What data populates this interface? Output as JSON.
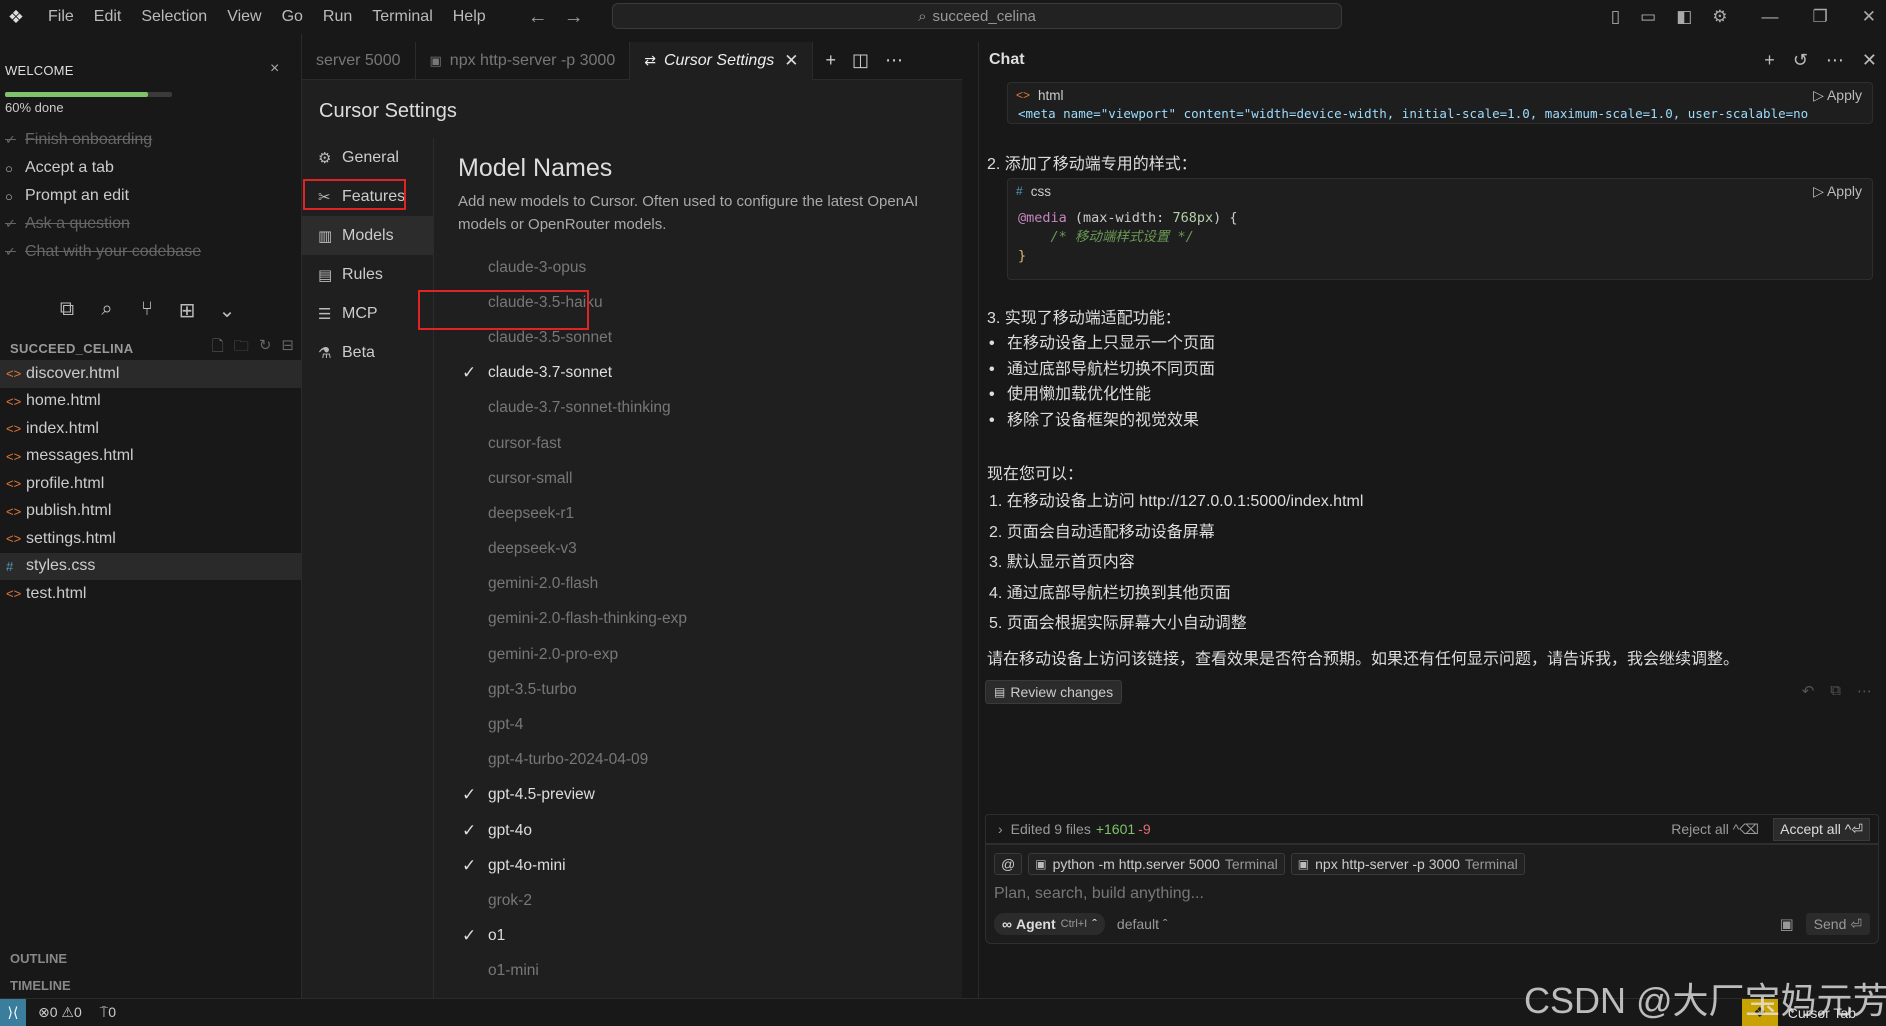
{
  "titlebar": {
    "menu": [
      "File",
      "Edit",
      "Selection",
      "View",
      "Go",
      "Run",
      "Terminal",
      "Help"
    ],
    "search": "succeed_celina"
  },
  "welcome": {
    "title": "WELCOME",
    "progress_text": "60% done",
    "progress_fraction": 0.6,
    "items": [
      {
        "label": "Finish onboarding",
        "done": true
      },
      {
        "label": "Accept a tab",
        "done": false
      },
      {
        "label": "Prompt an edit",
        "done": false
      },
      {
        "label": "Ask a question",
        "done": true
      },
      {
        "label": "Chat with your codebase",
        "done": true
      }
    ]
  },
  "explorer": {
    "title": "SUCCEED_CELINA",
    "files": [
      {
        "name": "discover.html",
        "type": "html",
        "active": true
      },
      {
        "name": "home.html",
        "type": "html",
        "active": false
      },
      {
        "name": "index.html",
        "type": "html",
        "active": false
      },
      {
        "name": "messages.html",
        "type": "html",
        "active": false
      },
      {
        "name": "profile.html",
        "type": "html",
        "active": false
      },
      {
        "name": "publish.html",
        "type": "html",
        "active": false
      },
      {
        "name": "settings.html",
        "type": "html",
        "active": false
      },
      {
        "name": "styles.css",
        "type": "css",
        "active": true
      },
      {
        "name": "test.html",
        "type": "html",
        "active": false
      }
    ],
    "outline": "OUTLINE",
    "timeline": "TIMELINE"
  },
  "tabs": [
    {
      "label": "server 5000",
      "active": false
    },
    {
      "label": "npx http-server -p 3000",
      "active": false
    },
    {
      "label": "Cursor Settings",
      "active": true
    }
  ],
  "settings": {
    "title": "Cursor Settings",
    "nav": [
      {
        "label": "General",
        "icon": "gear-icon"
      },
      {
        "label": "Features",
        "icon": "tools-icon"
      },
      {
        "label": "Models",
        "icon": "chart-icon",
        "selected": true
      },
      {
        "label": "Rules",
        "icon": "document-icon"
      },
      {
        "label": "MCP",
        "icon": "server-icon"
      },
      {
        "label": "Beta",
        "icon": "flask-icon"
      }
    ],
    "models_title": "Model Names",
    "models_desc": "Add new models to Cursor. Often used to configure the latest OpenAI models or OpenRouter models.",
    "models": [
      {
        "name": "claude-3-opus",
        "checked": false
      },
      {
        "name": "claude-3.5-haiku",
        "checked": false
      },
      {
        "name": "claude-3.5-sonnet",
        "checked": false
      },
      {
        "name": "claude-3.7-sonnet",
        "checked": true
      },
      {
        "name": "claude-3.7-sonnet-thinking",
        "checked": false
      },
      {
        "name": "cursor-fast",
        "checked": false
      },
      {
        "name": "cursor-small",
        "checked": false
      },
      {
        "name": "deepseek-r1",
        "checked": false
      },
      {
        "name": "deepseek-v3",
        "checked": false
      },
      {
        "name": "gemini-2.0-flash",
        "checked": false
      },
      {
        "name": "gemini-2.0-flash-thinking-exp",
        "checked": false
      },
      {
        "name": "gemini-2.0-pro-exp",
        "checked": false
      },
      {
        "name": "gpt-3.5-turbo",
        "checked": false
      },
      {
        "name": "gpt-4",
        "checked": false
      },
      {
        "name": "gpt-4-turbo-2024-04-09",
        "checked": false
      },
      {
        "name": "gpt-4.5-preview",
        "checked": true
      },
      {
        "name": "gpt-4o",
        "checked": true
      },
      {
        "name": "gpt-4o-mini",
        "checked": true
      },
      {
        "name": "grok-2",
        "checked": false
      },
      {
        "name": "o1",
        "checked": true
      },
      {
        "name": "o1-mini",
        "checked": false
      }
    ]
  },
  "chat": {
    "title": "Chat",
    "code1_lang": "html",
    "code1_line": "<meta name=\"viewport\" content=\"width=device-width, initial-scale=1.0, maximum-scale=1.0, user-scalable=no",
    "apply": "Apply",
    "step2": "2. 添加了移动端专用的样式：",
    "code2_lang": "css",
    "code2": {
      "media": "@media",
      "open": " (max-width: ",
      "px": "768px",
      "close": ") {",
      "comment": "/* 移动端样式设置 */",
      "end": "}"
    },
    "step3": "3. 实现了移动端适配功能：",
    "bullets": [
      "在移动设备上只显示一个页面",
      "通过底部导航栏切换不同页面",
      "使用懒加载优化性能",
      "移除了设备框架的视觉效果"
    ],
    "now_can": "现在您可以：",
    "steps": [
      "1. 在移动设备上访问 http://127.0.0.1:5000/index.html",
      "2. 页面会自动适配移动设备屏幕",
      "3. 默认显示首页内容",
      "4. 通过底部导航栏切换到其他页面",
      "5. 页面会根据实际屏幕大小自动调整"
    ],
    "closing": "请在移动设备上访问该链接，查看效果是否符合预期。如果还有任何显示问题，请告诉我，我会继续调整。",
    "review": "Review changes",
    "edited": "Edited 9 files",
    "plus": "+1601",
    "minus": "-9",
    "reject": "Reject all ^⌫",
    "accept": "Accept all ^⏎",
    "ctx": [
      {
        "label": "python -m http.server 5000",
        "sub": "Terminal"
      },
      {
        "label": "npx http-server -p 3000",
        "sub": "Terminal"
      }
    ],
    "placeholder": "Plan, search, build anything...",
    "agent": "Agent",
    "agent_kb": "Ctrl+I",
    "model_default": "default",
    "send": "Send ⏎"
  },
  "status": {
    "errors": "0",
    "warnings": "0",
    "ports": "0",
    "cursor_tab": "Cursor Tab"
  },
  "watermark": "CSDN @大厂宝妈元芳",
  "colors": {
    "accent": "#e02424",
    "progress": "#7fc26b",
    "html_icon": "#e37933",
    "css_icon": "#519aba"
  }
}
